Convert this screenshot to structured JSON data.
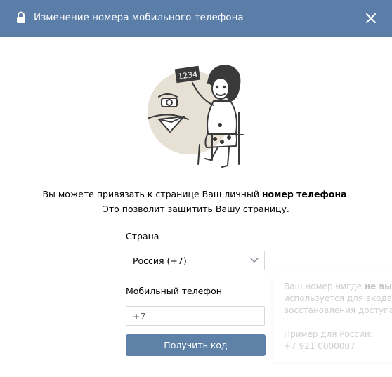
{
  "header": {
    "title": "Изменение номера мобильного телефона",
    "background_color": "#5b7ea8",
    "lock_icon": "lock-icon",
    "close_icon": "close-icon"
  },
  "intro": {
    "line1_prefix": "Вы можете привязать к странице Ваш личный ",
    "line1_bold": "номер телефона",
    "line1_suffix": ".",
    "line2": "Это позволит защитить Вашу страницу."
  },
  "form": {
    "country_label": "Страна",
    "country_value": "Россия (+7)",
    "phone_label": "Мобильный телефон",
    "phone_placeholder": "+7",
    "submit_label": "Получить код",
    "button_color": "#5e81a8"
  },
  "hint": {
    "line1_prefix": "Ваш номер нигде ",
    "line1_bold": "не выво",
    "line2": "используется для входа н",
    "line3": "восстановления доступа к",
    "example_label": "Пример для России:",
    "example_value": "+7 921 0000007"
  }
}
